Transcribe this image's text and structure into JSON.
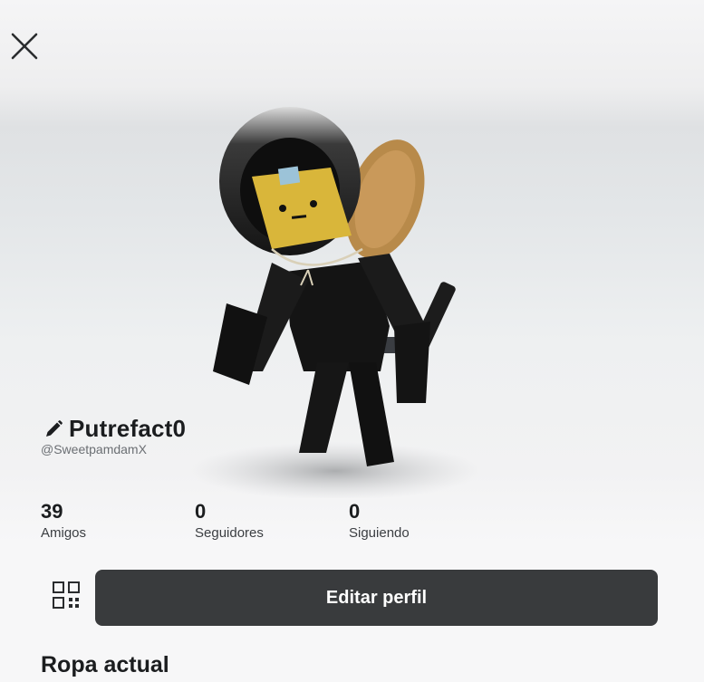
{
  "header": {
    "close_icon": "close-x-icon"
  },
  "profile": {
    "display_name": "Putrefact0",
    "handle": "@SweetpamdamX",
    "edit_name_icon": "pencil-icon"
  },
  "stats": [
    {
      "count": "39",
      "label": "Amigos"
    },
    {
      "count": "0",
      "label": "Seguidores"
    },
    {
      "count": "0",
      "label": "Siguiendo"
    }
  ],
  "actions": {
    "qr_icon": "qr-code-icon",
    "edit_profile_label": "Editar perfil"
  },
  "sections": {
    "current_outfit_title": "Ropa actual"
  },
  "colors": {
    "primary_button": "#393b3d",
    "text_primary": "#1b1d1f",
    "text_secondary": "#6b6f73"
  }
}
